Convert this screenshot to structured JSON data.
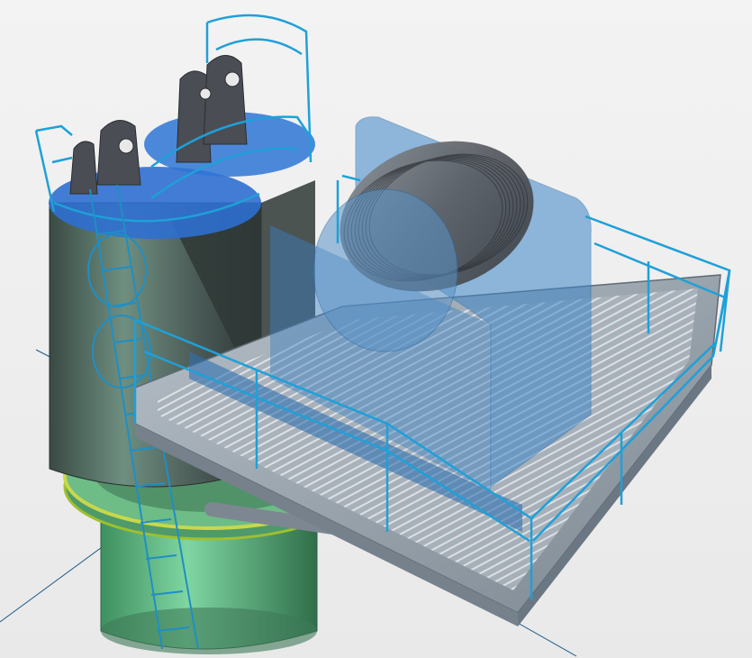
{
  "viewport": {
    "background": "#eeeeee",
    "colors": {
      "railing": "#1fa0d8",
      "steel_grey": "#5b5f66",
      "platform": "#9aa3ad",
      "grating": "#c8ced4",
      "glass_blue": "#3d86c8",
      "drum": "#6f7378",
      "base_green": "#5fbf87",
      "flange_yellow": "#c8d84a",
      "axis_line": "#1c5a8a"
    },
    "objects": [
      "vertical-tower-column",
      "top-lifting-lugs",
      "access-ladder",
      "circular-railing",
      "winch-platform",
      "cable-drum",
      "perimeter-handrail",
      "support-struts",
      "base-cylinder",
      "slewing-flange",
      "axis-lines"
    ]
  }
}
